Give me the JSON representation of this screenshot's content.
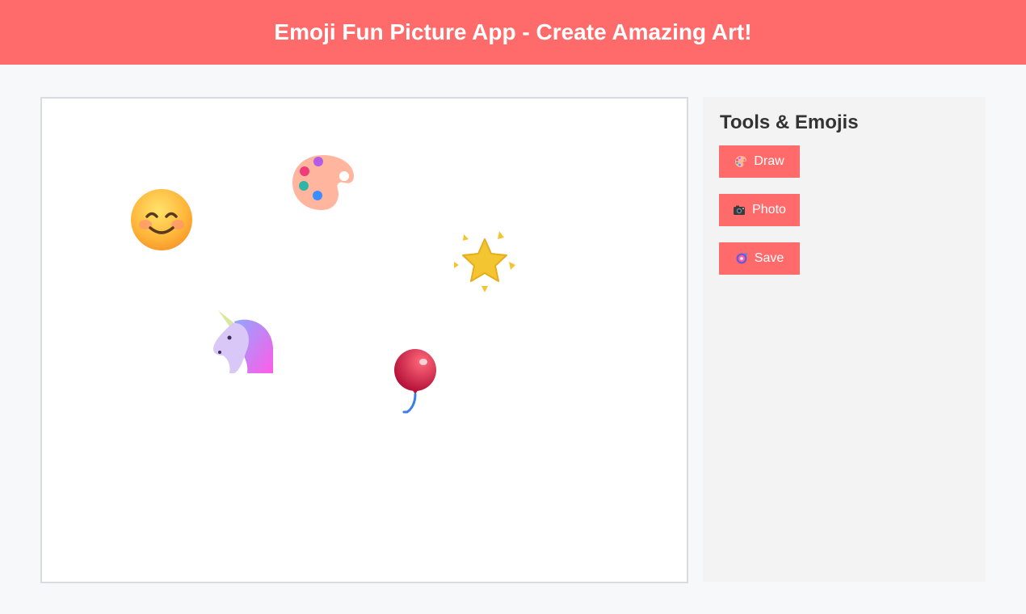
{
  "header": {
    "title": "Emoji Fun Picture App - Create Amazing Art!"
  },
  "canvas": {
    "emojis": [
      {
        "name": "smiling-face-emoji"
      },
      {
        "name": "artist-palette-emoji"
      },
      {
        "name": "glowing-star-emoji"
      },
      {
        "name": "unicorn-emoji"
      },
      {
        "name": "balloon-emoji"
      }
    ]
  },
  "sidebar": {
    "title": "Tools & Emojis",
    "buttons": [
      {
        "label": "Draw",
        "icon": "artist-palette-icon"
      },
      {
        "label": "Photo",
        "icon": "camera-icon"
      },
      {
        "label": "Save",
        "icon": "floppy-disk-icon"
      }
    ]
  },
  "colors": {
    "accent": "#ff6b6b",
    "background": "#f7f8fa",
    "sidebar_bg": "#f3f3f3",
    "canvas_border": "#d8dbe0"
  }
}
